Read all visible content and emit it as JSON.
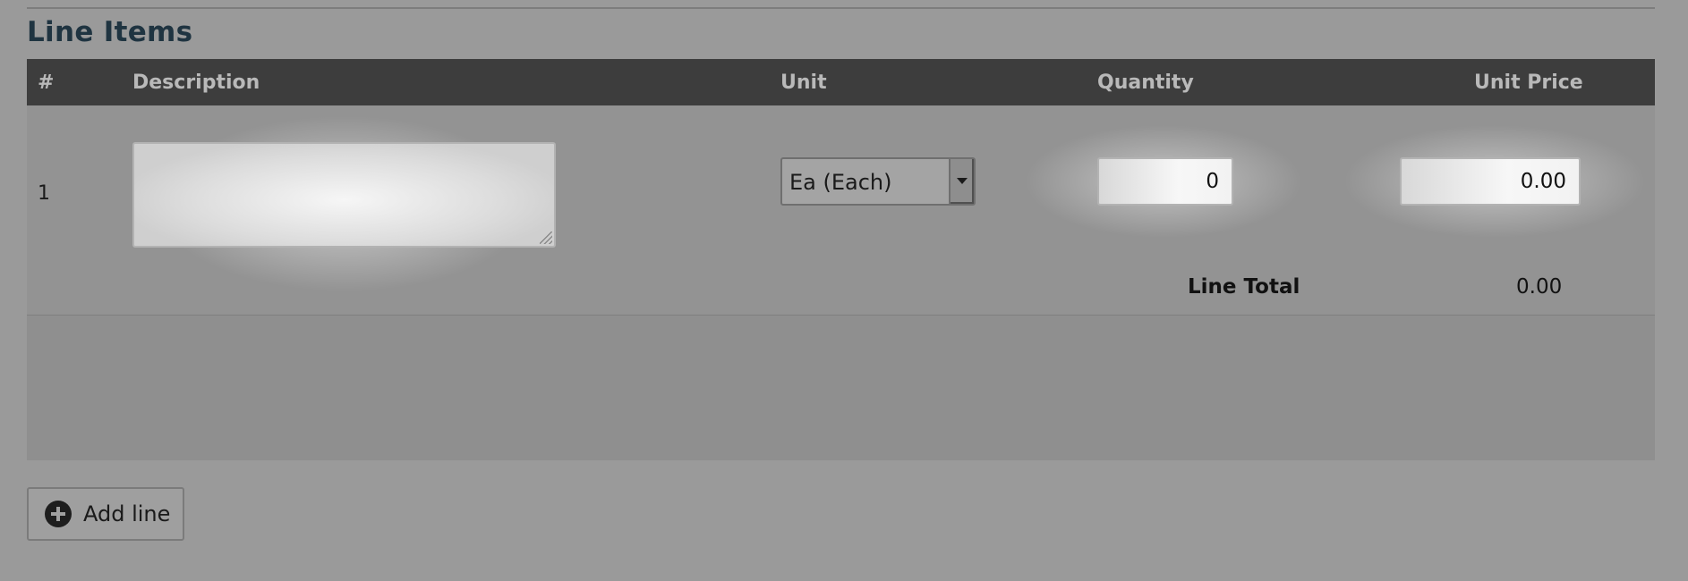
{
  "section": {
    "title": "Line Items"
  },
  "table": {
    "headers": {
      "number": "#",
      "description": "Description",
      "unit": "Unit",
      "quantity": "Quantity",
      "unit_price": "Unit Price"
    },
    "rows": [
      {
        "number": "1",
        "description": "",
        "unit": "Ea (Each)",
        "quantity": "0",
        "unit_price": "0.00",
        "line_total_label": "Line Total",
        "line_total": "0.00"
      }
    ]
  },
  "actions": {
    "add_line_label": "Add line",
    "add_line_icon": "plus-circle-icon"
  },
  "colors": {
    "header_bg": "#3d3d3d",
    "title_color": "#1f3441",
    "overlay_bg": "#9a9a9a"
  }
}
